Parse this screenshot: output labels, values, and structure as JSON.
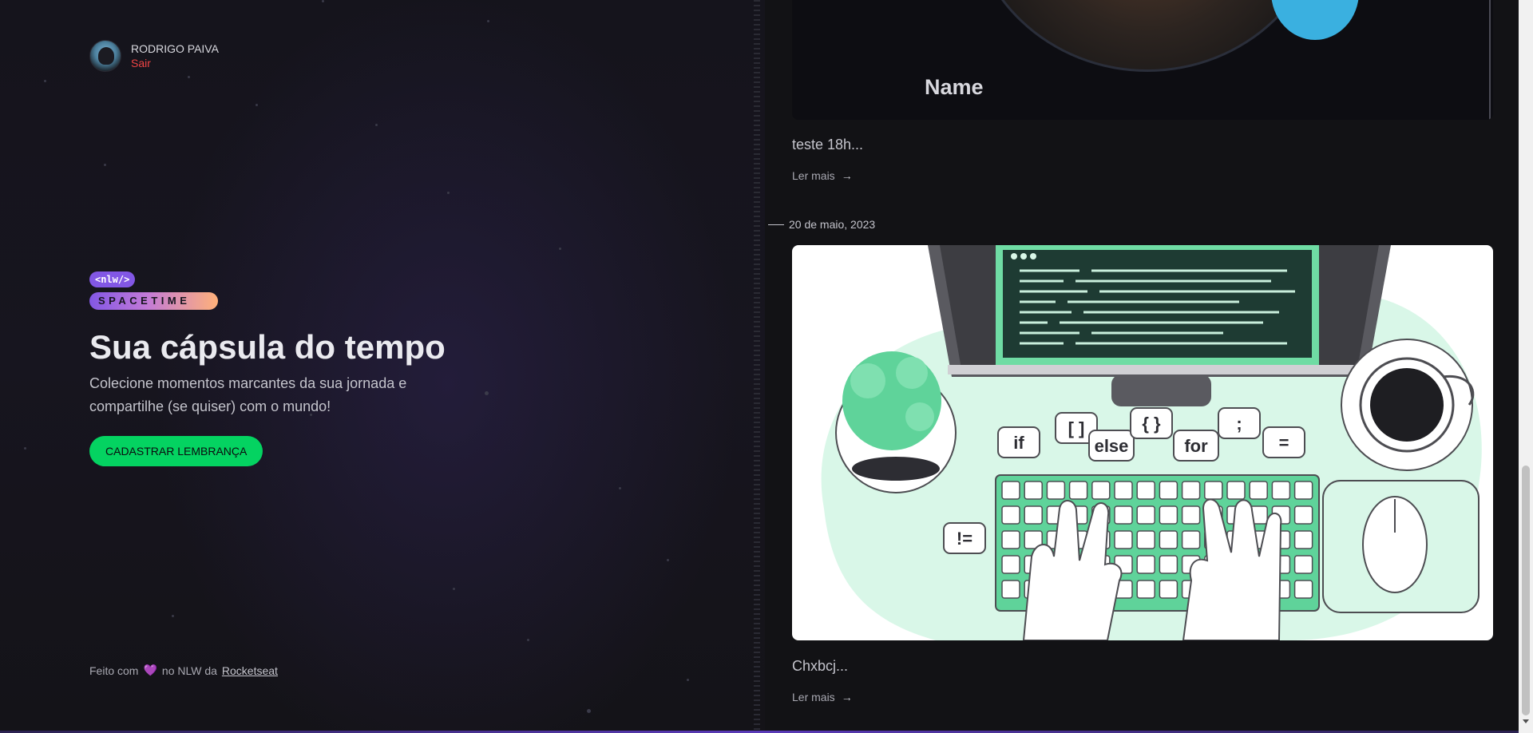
{
  "profile": {
    "name": "RODRIGO PAIVA",
    "logout": "Sair"
  },
  "logo": {
    "badge": "<nlw/>",
    "wordmark": "SPACETIME"
  },
  "hero": {
    "title": "Sua cápsula do tempo",
    "description": "Colecione momentos marcantes da sua jornada e compartilhe (se quiser) com o mundo!",
    "cta": "CADASTRAR LEMBRANÇA"
  },
  "footer": {
    "prefix": "Feito com",
    "middle": "no NLW da",
    "link": "Rocketseat"
  },
  "timeline": {
    "memories": [
      {
        "image_text": "Name",
        "excerpt": "teste 18h...",
        "read_more": "Ler mais"
      },
      {
        "date": "20 de maio, 2023",
        "excerpt": "Chxbcj...",
        "read_more": "Ler mais",
        "code_tokens": [
          "if",
          "[ ]",
          "else",
          "{ }",
          "for",
          ";",
          "=",
          "!="
        ]
      }
    ]
  },
  "colors": {
    "accent_purple": "#8257e5",
    "cta_green": "#04d361",
    "logout_red": "#ef4444",
    "illustration_green": "#5fd39a"
  }
}
